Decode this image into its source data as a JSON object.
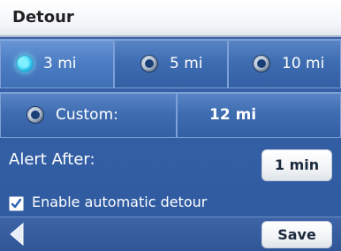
{
  "title": "Detour",
  "distance_options": [
    {
      "label": "3 mi",
      "selected": true
    },
    {
      "label": "5 mi",
      "selected": false
    },
    {
      "label": "10 mi",
      "selected": false
    }
  ],
  "custom": {
    "label": "Custom:",
    "value": "12 mi",
    "selected": false
  },
  "alert": {
    "label": "Alert After:",
    "value": "1 min"
  },
  "auto_detour": {
    "label": "Enable automatic detour",
    "checked": true
  },
  "footer": {
    "save_label": "Save"
  },
  "colors": {
    "panel_blue": "#3560a6",
    "selected_glow": "#6fe8ff"
  }
}
